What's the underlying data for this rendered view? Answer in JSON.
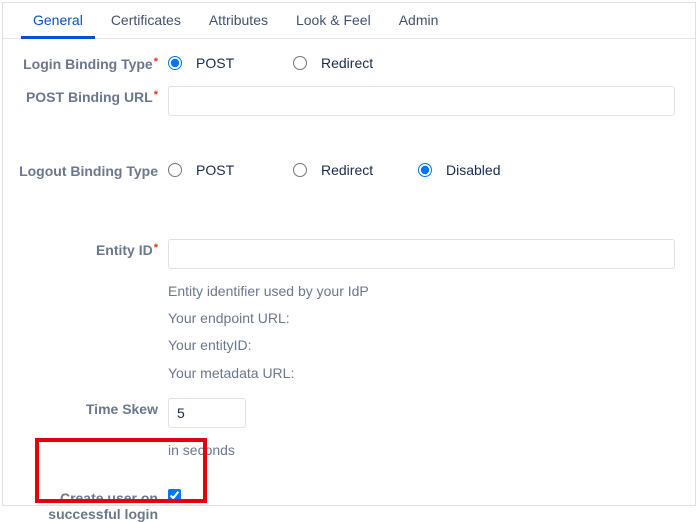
{
  "tabs": {
    "general": "General",
    "certificates": "Certificates",
    "attributes": "Attributes",
    "lookfeel": "Look & Feel",
    "admin": "Admin"
  },
  "labels": {
    "login_binding_type": "Login Binding Type",
    "post_binding_url": "POST Binding URL",
    "logout_binding_type": "Logout Binding Type",
    "entity_id": "Entity ID",
    "time_skew": "Time Skew",
    "create_user": "Create user on successful login"
  },
  "options": {
    "post": "POST",
    "redirect": "Redirect",
    "disabled": "Disabled"
  },
  "values": {
    "login_binding": "post",
    "logout_binding": "disabled",
    "post_binding_url": "",
    "entity_id": "",
    "time_skew": "5",
    "create_user_checked": true
  },
  "help": {
    "entity_identifier": "Entity identifier used by your IdP",
    "endpoint_url": "Your endpoint URL:",
    "entity_id_line": "Your entityID:",
    "metadata_url": "Your metadata URL:",
    "in_seconds": "in seconds"
  }
}
